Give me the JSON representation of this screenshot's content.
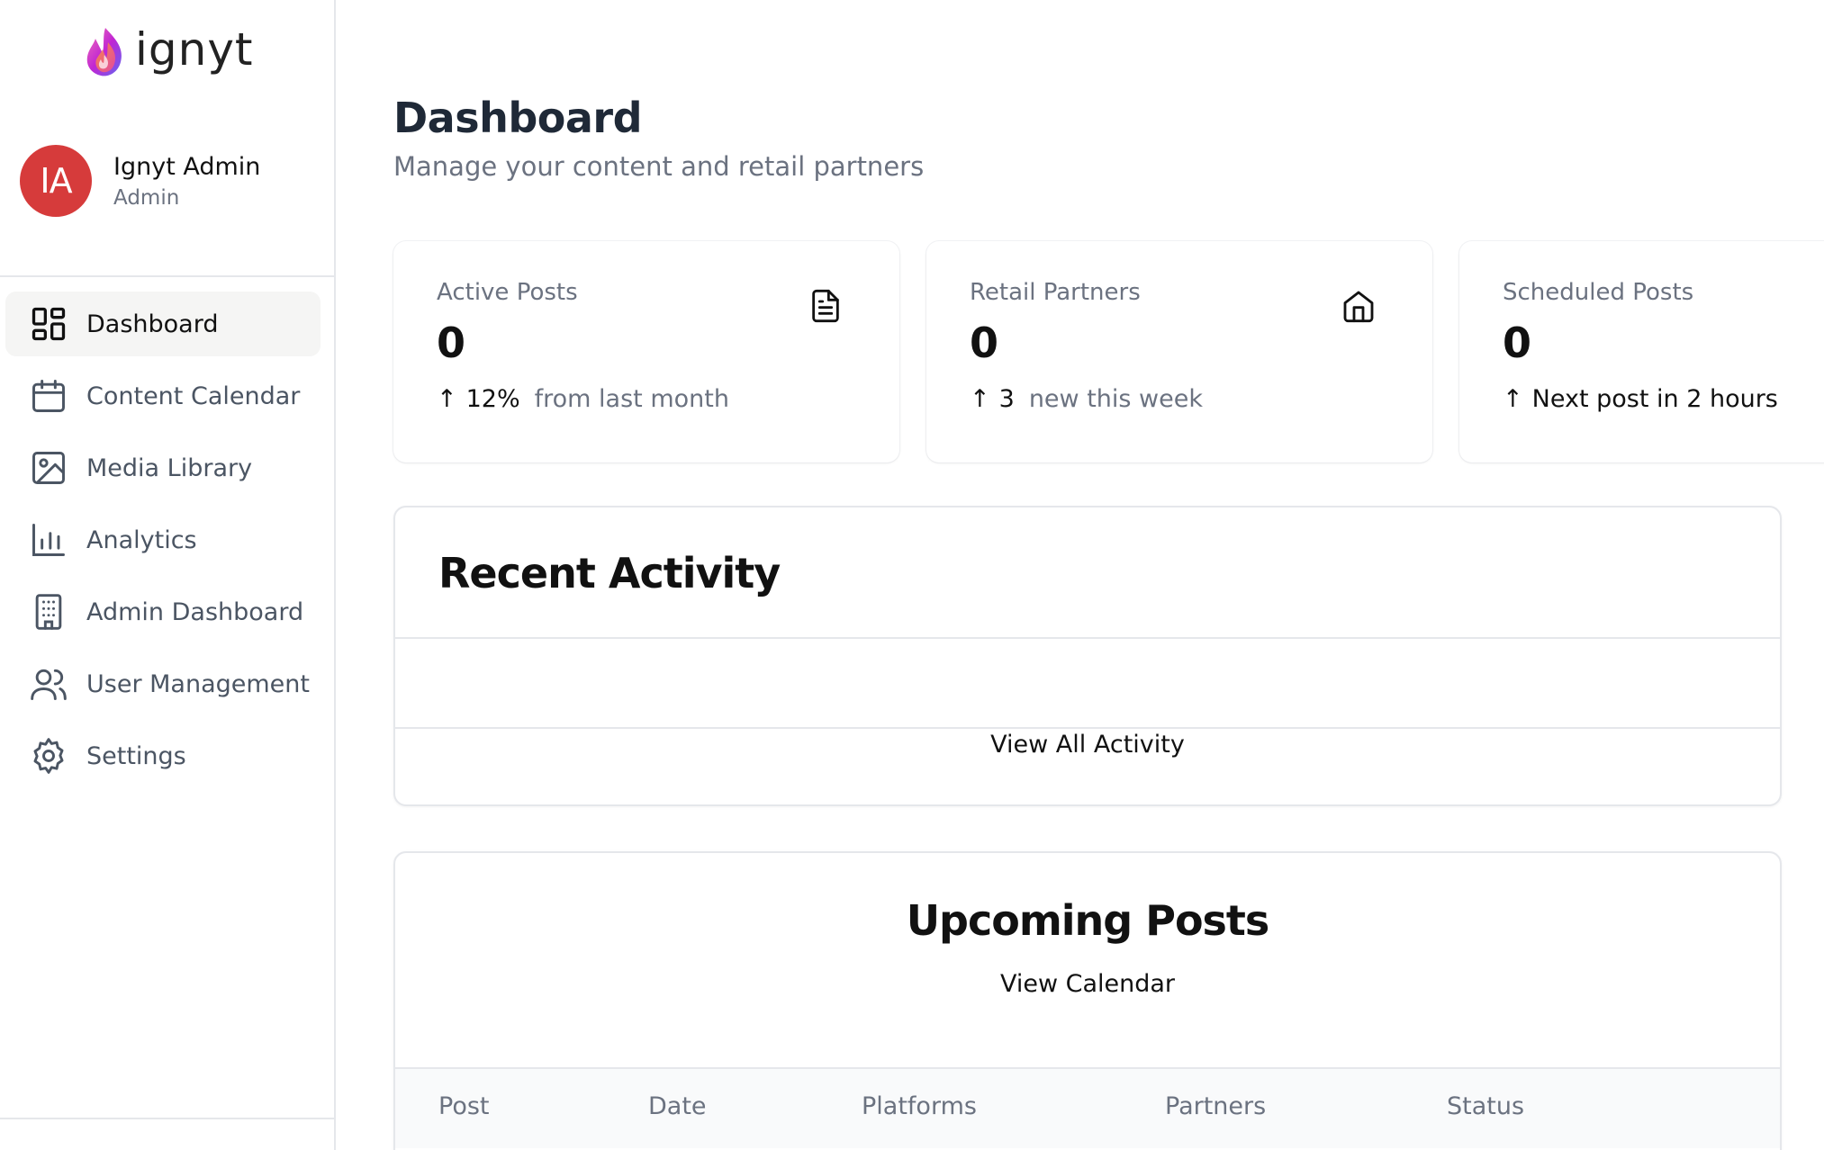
{
  "brand": {
    "name": "ignyt"
  },
  "profile": {
    "initials": "IA",
    "name": "Ignyt Admin",
    "role": "Admin"
  },
  "sidebar": {
    "items": [
      {
        "label": "Dashboard",
        "icon": "dashboard-grid-icon",
        "active": true
      },
      {
        "label": "Content Calendar",
        "icon": "calendar-icon",
        "active": false
      },
      {
        "label": "Media Library",
        "icon": "image-icon",
        "active": false
      },
      {
        "label": "Analytics",
        "icon": "bar-chart-icon",
        "active": false
      },
      {
        "label": "Admin Dashboard",
        "icon": "building-icon",
        "active": false
      },
      {
        "label": "User Management",
        "icon": "users-icon",
        "active": false
      },
      {
        "label": "Settings",
        "icon": "gear-icon",
        "active": false
      }
    ]
  },
  "header": {
    "title": "Dashboard",
    "subtitle": "Manage your content and retail partners"
  },
  "stats": [
    {
      "label": "Active Posts",
      "value": "0",
      "trend_arrow": "↑",
      "trend_value": "12%",
      "trend_note": "from last month",
      "icon": "document-icon"
    },
    {
      "label": "Retail Partners",
      "value": "0",
      "trend_arrow": "↑",
      "trend_value": "3",
      "trend_note": "new this week",
      "icon": "home-icon"
    },
    {
      "label": "Scheduled Posts",
      "value": "0",
      "trend_arrow": "↑",
      "trend_value": "Next post in 2 hours",
      "trend_note": "",
      "icon": "clock-icon"
    }
  ],
  "recent_activity": {
    "title": "Recent Activity",
    "link": "View All Activity"
  },
  "upcoming_posts": {
    "title": "Upcoming Posts",
    "link": "View Calendar",
    "columns": [
      "Post",
      "Date",
      "Platforms",
      "Partners",
      "Status"
    ]
  },
  "colors": {
    "avatar": "#d63b3b",
    "active_nav_bg": "#f5f5f4",
    "muted_text": "#6b7280",
    "border": "#e5e7eb"
  }
}
